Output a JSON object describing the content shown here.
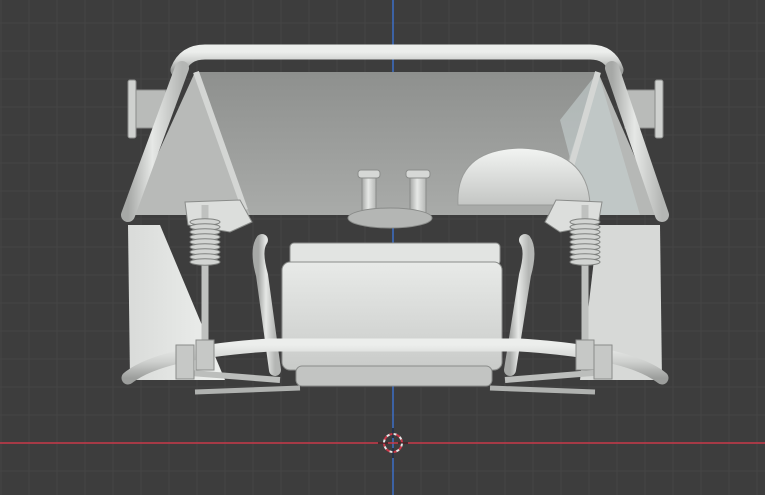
{
  "viewport": {
    "background": "#3d3d3d",
    "grid_minor_color": "#454545",
    "grid_major_color": "#333333",
    "axis_x_color": "#c9394a",
    "axis_z_color": "#3d6fc6"
  },
  "model": {
    "icon": "buggy-chassis-model",
    "body_color": "#c8cac8",
    "tube_color": "#d8dad8",
    "shadow_color": "#9a9c9a"
  },
  "cursor": {
    "icon": "3d-cursor-icon"
  }
}
